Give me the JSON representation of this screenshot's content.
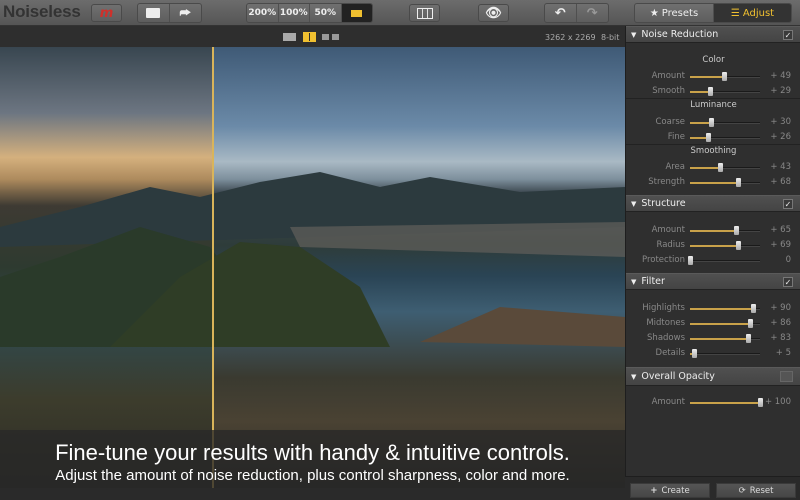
{
  "app": {
    "title": "Noiseless",
    "logo": "m"
  },
  "toolbar": {
    "zoom": [
      "200%",
      "100%",
      "50%"
    ],
    "presets_label": "Presets",
    "adjust_label": "Adjust"
  },
  "image_info": {
    "dimensions": "3262 x 2269",
    "bit_depth": "8-bit"
  },
  "caption": {
    "headline": "Fine-tune your results with handy & intuitive controls.",
    "subline": "Adjust the amount of noise reduction, plus control sharpness, color and more."
  },
  "panel": {
    "noise_reduction": {
      "title": "Noise Reduction",
      "checked": true,
      "color": {
        "label": "Color",
        "rows": [
          {
            "label": "Amount",
            "value": 49,
            "display": "+ 49"
          },
          {
            "label": "Smooth",
            "value": 29,
            "display": "+ 29"
          }
        ]
      },
      "luminance": {
        "label": "Luminance",
        "rows": [
          {
            "label": "Coarse",
            "value": 30,
            "display": "+ 30"
          },
          {
            "label": "Fine",
            "value": 26,
            "display": "+ 26"
          }
        ]
      },
      "smoothing": {
        "label": "Smoothing",
        "rows": [
          {
            "label": "Area",
            "value": 43,
            "display": "+ 43"
          },
          {
            "label": "Strength",
            "value": 68,
            "display": "+ 68"
          }
        ]
      }
    },
    "structure": {
      "title": "Structure",
      "checked": true,
      "rows": [
        {
          "label": "Amount",
          "value": 65,
          "display": "+ 65"
        },
        {
          "label": "Radius",
          "value": 69,
          "display": "+ 69"
        },
        {
          "label": "Protection",
          "value": 0,
          "display": "0"
        }
      ]
    },
    "filter": {
      "title": "Filter",
      "checked": true,
      "rows": [
        {
          "label": "Highlights",
          "value": 90,
          "display": "+ 90"
        },
        {
          "label": "Midtones",
          "value": 86,
          "display": "+ 86"
        },
        {
          "label": "Shadows",
          "value": 83,
          "display": "+ 83"
        },
        {
          "label": "Details",
          "value": 5,
          "display": "+ 5"
        }
      ]
    },
    "overall_opacity": {
      "title": "Overall Opacity",
      "checked": false,
      "rows": [
        {
          "label": "Amount",
          "value": 100,
          "display": "+ 100"
        }
      ]
    }
  },
  "footer": {
    "create_label": "Create",
    "reset_label": "Reset"
  },
  "colors": {
    "accent": "#c9a24a",
    "logo_red": "#d0302a",
    "active_icon": "#f0c030"
  }
}
